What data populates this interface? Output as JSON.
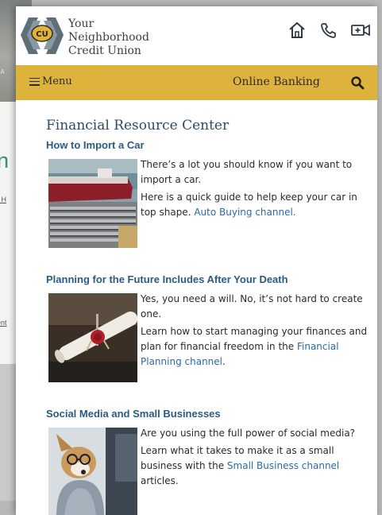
{
  "background": {
    "heading_fragment": "n",
    "link_fragment_1": "r H",
    "link_fragment_2": "ent",
    "photo_caption_fragment": "·  A"
  },
  "header": {
    "logo_badge": "CU",
    "logo_lines": [
      "Your",
      "Neighborhood",
      "Credit Union"
    ],
    "icons": [
      "home-icon",
      "phone-icon",
      "video-call-icon"
    ]
  },
  "navbar": {
    "menu_label": "Menu",
    "online_banking_label": "Online Banking",
    "search_icon": "search-icon",
    "color": "#ddb33c"
  },
  "main": {
    "section_title": "Financial Resource Center",
    "articles": [
      {
        "title": "How to Import a Car",
        "image": "cargo-ship-with-cars",
        "paragraph_1": "There’s a lot you should know if you want to import a car.",
        "paragraph_2_prefix": "Here is a quick guide to help keep your car in top shape. ",
        "link_text": "Auto Buying channel.",
        "paragraph_2_suffix": ""
      },
      {
        "title": "Planning for the Future Includes After Your Death",
        "image": "sealed-will-scroll",
        "paragraph_1": "Yes, you need a will. No, it’s not hard to create one.",
        "paragraph_2_prefix": "Learn how to start managing your finances and plan for financial freedom in the ",
        "link_text": "Financial Planning channel",
        "paragraph_2_suffix": "."
      },
      {
        "title": "Social Media and Small Businesses",
        "image": "dog-with-glasses-at-laptop",
        "paragraph_1": "Are you using the full power of social media?",
        "paragraph_2_prefix": "Learn what it takes to make it as a small business with the ",
        "link_text": "Small Business channel",
        "paragraph_2_suffix": " articles."
      }
    ]
  },
  "colors": {
    "title_blue": "#2b5a84",
    "link_blue": "#2b6aa8",
    "heading_slate": "#2f4a64"
  }
}
